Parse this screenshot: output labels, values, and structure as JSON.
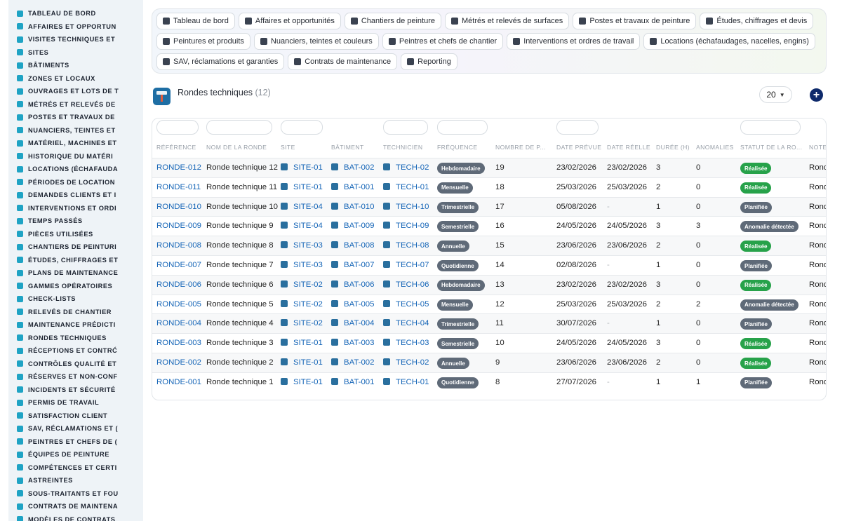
{
  "sidebar": {
    "items": [
      "TABLEAU DE BORD",
      "AFFAIRES ET OPPORTUN",
      "VISITES TECHNIQUES ET",
      "SITES",
      "BÂTIMENTS",
      "ZONES ET LOCAUX",
      "OUVRAGES ET LOTS DE T",
      "MÉTRÉS ET RELEVÉS DE",
      "POSTES ET TRAVAUX DE",
      "NUANCIERS, TEINTES ET",
      "MATÉRIEL, MACHINES ET",
      "HISTORIQUE DU MATÉRI",
      "LOCATIONS (ÉCHAFAUDA",
      "PÉRIODES DE LOCATION",
      "DEMANDES CLIENTS ET I",
      "INTERVENTIONS ET ORDI",
      "TEMPS PASSÉS",
      "PIÈCES UTILISÉES",
      "CHANTIERS DE PEINTURI",
      "ÉTUDES, CHIFFRAGES ET",
      "PLANS DE MAINTENANCE",
      "GAMMES OPÉRATOIRES",
      "CHECK-LISTS",
      "RELEVÉS DE CHANTIER",
      "MAINTENANCE PRÉDICTI",
      "RONDES TECHNIQUES",
      "RÉCEPTIONS ET CONTRĆ",
      "CONTRÔLES QUALITÉ ET",
      "RÉSERVES ET NON-CONF",
      "INCIDENTS ET SÉCURITÉ",
      "PERMIS DE TRAVAIL",
      "SATISFACTION CLIENT",
      "SAV, RÉCLAMATIONS ET (",
      "PEINTRES ET CHEFS DE (",
      "ÉQUIPES DE PEINTURE",
      "COMPÉTENCES ET CERTI",
      "ASTREINTES",
      "SOUS-TRAITANTS ET FOU",
      "CONTRATS DE MAINTENA",
      "MODÈLES DE CONTRATS"
    ]
  },
  "nav": {
    "row1": [
      "Tableau de bord",
      "Affaires et opportunités",
      "Chantiers de peinture",
      "Métrés et relevés de surfaces",
      "Postes et travaux de peinture",
      "Études, chiffrages et devis"
    ],
    "row2": [
      "Peintures et produits",
      "Nuanciers, teintes et couleurs",
      "Peintres et chefs de chantier",
      "Interventions et ordres de travail",
      "Locations (échafaudages, nacelles, engins)"
    ],
    "row3": [
      "SAV, réclamations et garanties",
      "Contrats de maintenance",
      "Reporting"
    ]
  },
  "page": {
    "title": "Rondes techniques",
    "count": "(12)",
    "per_page": "20",
    "add_label": "+"
  },
  "table": {
    "headers": [
      "RÉFÉRENCE",
      "NOM DE LA RONDE",
      "SITE",
      "BÂTIMENT",
      "TECHNICIEN",
      "FRÉQUENCE",
      "NOMBRE DE P...",
      "DATE PRÉVUE",
      "DATE RÉELLE",
      "DURÉE (H)",
      "ANOMALIES",
      "STATUT DE LA RO...",
      "NOTE"
    ],
    "rows": [
      {
        "ref": "RONDE-012",
        "name": "Ronde technique 12",
        "site": "SITE-01",
        "bat": "BAT-002",
        "tech": "TECH-02",
        "freq": "Hebdomadaire",
        "nb": "19",
        "prev": "23/02/2026",
        "reel": "23/02/2026",
        "duree": "3",
        "anom": "0",
        "statut": "Réalisée",
        "statut_color": "green",
        "note": "Rond"
      },
      {
        "ref": "RONDE-011",
        "name": "Ronde technique 11",
        "site": "SITE-01",
        "bat": "BAT-001",
        "tech": "TECH-01",
        "freq": "Mensuelle",
        "nb": "18",
        "prev": "25/03/2026",
        "reel": "25/03/2026",
        "duree": "2",
        "anom": "0",
        "statut": "Réalisée",
        "statut_color": "green",
        "note": "Rond"
      },
      {
        "ref": "RONDE-010",
        "name": "Ronde technique 10",
        "site": "SITE-04",
        "bat": "BAT-010",
        "tech": "TECH-10",
        "freq": "Trimestrielle",
        "nb": "17",
        "prev": "05/08/2026",
        "reel": "-",
        "duree": "1",
        "anom": "0",
        "statut": "Planifiée",
        "statut_color": "gray",
        "note": "Rond"
      },
      {
        "ref": "RONDE-009",
        "name": "Ronde technique 9",
        "site": "SITE-04",
        "bat": "BAT-009",
        "tech": "TECH-09",
        "freq": "Semestrielle",
        "nb": "16",
        "prev": "24/05/2026",
        "reel": "24/05/2026",
        "duree": "3",
        "anom": "3",
        "statut": "Anomalie détectée",
        "statut_color": "gray",
        "note": "Rond"
      },
      {
        "ref": "RONDE-008",
        "name": "Ronde technique 8",
        "site": "SITE-03",
        "bat": "BAT-008",
        "tech": "TECH-08",
        "freq": "Annuelle",
        "nb": "15",
        "prev": "23/06/2026",
        "reel": "23/06/2026",
        "duree": "2",
        "anom": "0",
        "statut": "Réalisée",
        "statut_color": "green",
        "note": "Rond"
      },
      {
        "ref": "RONDE-007",
        "name": "Ronde technique 7",
        "site": "SITE-03",
        "bat": "BAT-007",
        "tech": "TECH-07",
        "freq": "Quotidienne",
        "nb": "14",
        "prev": "02/08/2026",
        "reel": "-",
        "duree": "1",
        "anom": "0",
        "statut": "Planifiée",
        "statut_color": "gray",
        "note": "Rond"
      },
      {
        "ref": "RONDE-006",
        "name": "Ronde technique 6",
        "site": "SITE-02",
        "bat": "BAT-006",
        "tech": "TECH-06",
        "freq": "Hebdomadaire",
        "nb": "13",
        "prev": "23/02/2026",
        "reel": "23/02/2026",
        "duree": "3",
        "anom": "0",
        "statut": "Réalisée",
        "statut_color": "green",
        "note": "Rond"
      },
      {
        "ref": "RONDE-005",
        "name": "Ronde technique 5",
        "site": "SITE-02",
        "bat": "BAT-005",
        "tech": "TECH-05",
        "freq": "Mensuelle",
        "nb": "12",
        "prev": "25/03/2026",
        "reel": "25/03/2026",
        "duree": "2",
        "anom": "2",
        "statut": "Anomalie détectée",
        "statut_color": "gray",
        "note": "Rond"
      },
      {
        "ref": "RONDE-004",
        "name": "Ronde technique 4",
        "site": "SITE-02",
        "bat": "BAT-004",
        "tech": "TECH-04",
        "freq": "Trimestrielle",
        "nb": "11",
        "prev": "30/07/2026",
        "reel": "-",
        "duree": "1",
        "anom": "0",
        "statut": "Planifiée",
        "statut_color": "gray",
        "note": "Rond"
      },
      {
        "ref": "RONDE-003",
        "name": "Ronde technique 3",
        "site": "SITE-01",
        "bat": "BAT-003",
        "tech": "TECH-03",
        "freq": "Semestrielle",
        "nb": "10",
        "prev": "24/05/2026",
        "reel": "24/05/2026",
        "duree": "3",
        "anom": "0",
        "statut": "Réalisée",
        "statut_color": "green",
        "note": "Rond"
      },
      {
        "ref": "RONDE-002",
        "name": "Ronde technique 2",
        "site": "SITE-01",
        "bat": "BAT-002",
        "tech": "TECH-02",
        "freq": "Annuelle",
        "nb": "9",
        "prev": "23/06/2026",
        "reel": "23/06/2026",
        "duree": "2",
        "anom": "0",
        "statut": "Réalisée",
        "statut_color": "green",
        "note": "Rond"
      },
      {
        "ref": "RONDE-001",
        "name": "Ronde technique 1",
        "site": "SITE-01",
        "bat": "BAT-001",
        "tech": "TECH-01",
        "freq": "Quotidienne",
        "nb": "8",
        "prev": "27/07/2026",
        "reel": "-",
        "duree": "1",
        "anom": "1",
        "statut": "Planifiée",
        "statut_color": "gray",
        "note": "Rond"
      }
    ]
  },
  "colors": {
    "link": "#1565b7",
    "badge_gray": "#5f6a78",
    "badge_green": "#27a24a",
    "accent": "#1fa3c4",
    "add_button": "#0e2a6b"
  },
  "icons": {
    "sidebar": "menu-item-icon",
    "nav": "nav-chip-icon",
    "row": "entity-icon"
  }
}
